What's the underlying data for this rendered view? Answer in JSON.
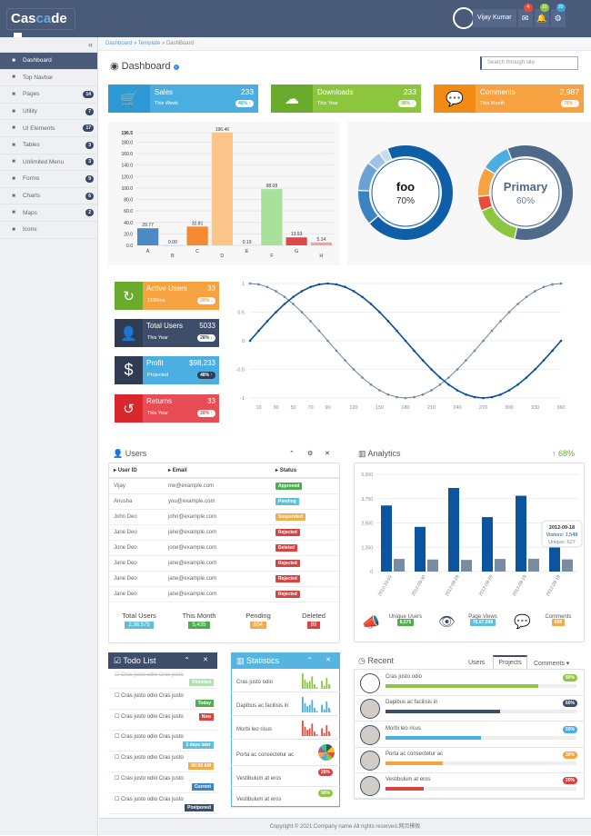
{
  "app": {
    "logo_pre": "Cas",
    "logo_mid": "ca",
    "logo_post": "de"
  },
  "topbar": {
    "user_name": "Vijay Kumar",
    "badges": [
      {
        "icon": "envelope-icon",
        "count": "4",
        "color": "#e84c3d"
      },
      {
        "icon": "bell-icon",
        "count": "10",
        "color": "#8cc63f"
      },
      {
        "icon": "gears-icon",
        "count": "20",
        "color": "#3aa5dc"
      }
    ]
  },
  "sidebar": {
    "items": [
      {
        "label": "Dashboard",
        "icon": "home-icon",
        "count": null
      },
      {
        "label": "Top Navbar",
        "icon": "navbar-icon",
        "count": null
      },
      {
        "label": "Pages",
        "icon": "pages-icon",
        "count": "14"
      },
      {
        "label": "Utility",
        "icon": "utility-icon",
        "count": "7"
      },
      {
        "label": "UI Elements",
        "icon": "user-icon",
        "count": "17"
      },
      {
        "label": "Tables",
        "icon": "table-icon",
        "count": "3"
      },
      {
        "label": "Unlimited Menu",
        "icon": "sitemap-icon",
        "count": "3"
      },
      {
        "label": "Forms",
        "icon": "form-icon",
        "count": "9"
      },
      {
        "label": "Charts",
        "icon": "chart-icon",
        "count": "6"
      },
      {
        "label": "Maps",
        "icon": "map-marker-icon",
        "count": "2"
      },
      {
        "label": "Icons",
        "icon": "icons-icon",
        "count": null
      }
    ]
  },
  "breadcrumb": [
    "Dashboard",
    "Template",
    "DashBoard"
  ],
  "page": {
    "title": "Dashboard",
    "search_placeholder": "Search through site"
  },
  "stats": [
    {
      "label": "Sales",
      "value": "233",
      "sub": "This Week",
      "pct": "48% ↑",
      "color": "#4aaee0",
      "icon_color": "#2d9ad6"
    },
    {
      "label": "Downloads",
      "value": "233",
      "sub": "This Year",
      "pct": "98% ↑",
      "color": "#8cc63f",
      "icon_color": "#6aab2e"
    },
    {
      "label": "Comments",
      "value": "2,987",
      "sub": "This Month",
      "pct": "78% ↑",
      "color": "#f7a240",
      "icon_color": "#f28b14"
    }
  ],
  "mini_stats": [
    {
      "label": "Active Users",
      "value": "33",
      "sub": "1500ms",
      "pct": "28% ↓"
    },
    {
      "label": "Total Users",
      "value": "5033",
      "sub": "This Year",
      "pct": "28% ↓"
    },
    {
      "label": "Profit",
      "value": "$98,233",
      "sub": "Projected",
      "pct": "48% ↑"
    },
    {
      "label": "Returns",
      "value": "33",
      "sub": "This Year",
      "pct": "28% ↑"
    }
  ],
  "chart_data": [
    {
      "type": "bar",
      "categories": [
        "A",
        "B",
        "C",
        "D",
        "E",
        "F",
        "G",
        "H"
      ],
      "values": [
        29.77,
        0.0,
        32.81,
        196.46,
        0.19,
        98.08,
        13.93,
        5.14
      ],
      "colors": [
        "#4a8bc4",
        "#aec7e8",
        "#f58a30",
        "#fdc48a",
        "#c5e0ec",
        "#a8e29a",
        "#e04848",
        "#f8a0a0"
      ],
      "ylim": [
        0,
        196.5
      ],
      "yticks": [
        "0.0",
        "20.0",
        "40.0",
        "60.0",
        "80.0",
        "100.0",
        "120.0",
        "140.0",
        "160.0",
        "180.0",
        "196.5"
      ]
    },
    {
      "type": "pie",
      "title": "foo",
      "subtitle": "70%",
      "segments": [
        70,
        12,
        10,
        5,
        3
      ]
    },
    {
      "type": "pie",
      "title": "Primary",
      "subtitle": "60%",
      "segments": [
        60,
        15,
        5,
        10,
        10
      ]
    },
    {
      "type": "line",
      "x": [
        0,
        10,
        20,
        30,
        40,
        50,
        60,
        70,
        80,
        90,
        100,
        110,
        120,
        130,
        140,
        150,
        160,
        170,
        180,
        190,
        200,
        210,
        220,
        230,
        240,
        250,
        260,
        270,
        280,
        290,
        300,
        310,
        320,
        330,
        340,
        350,
        360
      ],
      "series": [
        {
          "name": "sin",
          "fn": "sin"
        },
        {
          "name": "cos",
          "fn": "cos"
        }
      ],
      "xticks": [
        "10",
        "30",
        "50",
        "70",
        "90",
        "120",
        "150",
        "180",
        "210",
        "240",
        "270",
        "300",
        "330",
        "360"
      ],
      "yticks": [
        "1",
        "0.5",
        "0",
        "-0.5",
        "-1"
      ],
      "ylim": [
        -1,
        1
      ]
    },
    {
      "type": "bar",
      "title": "Analytics",
      "categories": [
        "2012-10-01",
        "2012-09-30",
        "2012-09-29",
        "2012-09-20",
        "2012-09-19",
        "2012-09-18"
      ],
      "series": [
        {
          "name": "Visitors",
          "values": [
            3400,
            2300,
            4300,
            2800,
            3900,
            1548
          ]
        },
        {
          "name": "Unique",
          "values": [
            650,
            620,
            600,
            650,
            660,
            627
          ]
        }
      ],
      "ylim": [
        0,
        5000
      ],
      "yticks": [
        "0",
        "1,250",
        "2,500",
        "3,750",
        "5,000"
      ],
      "tooltip": {
        "date": "2012-09-18",
        "visitors": "Visitors: 1,548",
        "unique": "Unique: 627"
      }
    }
  ],
  "users": {
    "title": "Users",
    "headers": [
      "User ID",
      "Email",
      "Status"
    ],
    "rows": [
      {
        "id": "Vijay",
        "email": "me@example.com",
        "status": "Approved",
        "color": "#4cae4c"
      },
      {
        "id": "Anusha",
        "email": "you@example.com",
        "status": "Pending",
        "color": "#5bc0de"
      },
      {
        "id": "John Deo",
        "email": "john@example.com",
        "status": "Suspended",
        "color": "#f0ad4e"
      },
      {
        "id": "Jane Deo",
        "email": "jane@example.com",
        "status": "Rejected",
        "color": "#d9423f"
      },
      {
        "id": "Jone Deo",
        "email": "jone@example.com",
        "status": "Deleted",
        "color": "#d9423f"
      },
      {
        "id": "Jane Deo",
        "email": "jane@example.com",
        "status": "Rejected",
        "color": "#d9423f"
      },
      {
        "id": "Jane Deo",
        "email": "jane@example.com",
        "status": "Rejected",
        "color": "#d9423f"
      },
      {
        "id": "Jane Deo",
        "email": "jane@example.com",
        "status": "Rejected",
        "color": "#d9423f"
      }
    ],
    "summary": [
      {
        "label": "Total Users",
        "value": "2,38,575",
        "color": "#5bc0de"
      },
      {
        "label": "This Month",
        "value": "5,435",
        "color": "#4cae4c"
      },
      {
        "label": "Pending",
        "value": "854",
        "color": "#f0ad4e"
      },
      {
        "label": "Deleted",
        "value": "89",
        "color": "#d9423f"
      }
    ]
  },
  "analytics": {
    "title": "Analytics",
    "trend": "68%",
    "footer": [
      {
        "label": "Unique Users",
        "value": "8,575",
        "color": "#4cae4c"
      },
      {
        "label": "Page Views",
        "value": "76,67,598",
        "color": "#5bc0de"
      },
      {
        "label": "Comments",
        "value": "658",
        "color": "#f0ad4e"
      }
    ]
  },
  "todo": {
    "title": "Todo List",
    "items": [
      {
        "text": "Cras justo odio Cras justo",
        "tag": "Finished",
        "color": "#b5e0b5",
        "done": true
      },
      {
        "text": "Cras justo odio Cras justo",
        "tag": "Today",
        "color": "#4cae4c"
      },
      {
        "text": "Cras justo odio Cras justo",
        "tag": "New",
        "color": "#d9423f"
      },
      {
        "text": "Cras justo odio Cras justo",
        "tag": "2 days later",
        "color": "#5bc0de"
      },
      {
        "text": "Cras justo odio Cras justo",
        "tag": "06:58 AM",
        "color": "#f0ad4e"
      },
      {
        "text": "Cras justo odio Cras justo",
        "tag": "Current",
        "color": "#3a85c8"
      },
      {
        "text": "Cras justo odio Cras justo",
        "tag": "Postponed",
        "color": "#3e4d6a"
      }
    ]
  },
  "statistics": {
    "title": "Statistics",
    "items": [
      {
        "text": "Cras justo odio",
        "kind": "spark",
        "color": "#8cc63f"
      },
      {
        "text": "Dapibus ac facilisis in",
        "kind": "spark",
        "color": "#4aaee0"
      },
      {
        "text": "Morbi leo risus",
        "kind": "spark",
        "color": "#e84c3d"
      },
      {
        "text": "Porta ac consectetur ac",
        "kind": "pie"
      },
      {
        "text": "Vestibulum at eros",
        "kind": "badge",
        "badge": "20%",
        "color": "#d9423f"
      },
      {
        "text": "Vestibulum at eros",
        "kind": "badge",
        "badge": "90%",
        "color": "#8cc63f"
      }
    ]
  },
  "recent": {
    "title": "Recent",
    "tabs": [
      "Users",
      "Projects",
      "Comments ▾"
    ],
    "items": [
      {
        "text": "Cras justo odio",
        "pct": "80%",
        "value": 0.8,
        "color": "#8cc63f"
      },
      {
        "text": "Dapibus ac facilisis in",
        "pct": "60%",
        "value": 0.6,
        "color": "#3e4d6a"
      },
      {
        "text": "Morbi leo risus",
        "pct": "50%",
        "value": 0.5,
        "color": "#4aaee0"
      },
      {
        "text": "Porta ac consectetur ac",
        "pct": "30%",
        "value": 0.3,
        "color": "#f7a240"
      },
      {
        "text": "Vestibulum at eros",
        "pct": "20%",
        "value": 0.2,
        "color": "#d9423f"
      }
    ]
  },
  "footer": {
    "text": "Copyright © 2021.Company name All rights reserved.网页模板"
  }
}
